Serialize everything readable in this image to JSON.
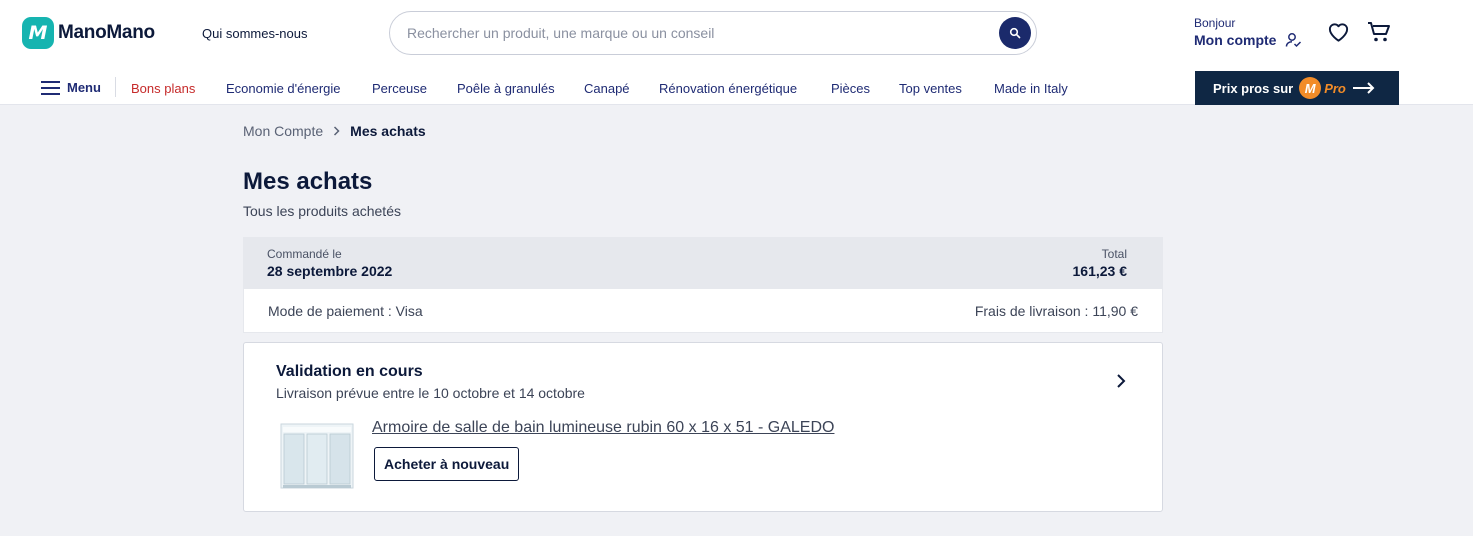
{
  "header": {
    "logo_text": "ManoMano",
    "logo_mark": "M",
    "about_link": "Qui sommes-nous",
    "search_placeholder": "Rechercher un produit, une marque ou un conseil",
    "greeting": "Bonjour",
    "account_label": "Mon compte"
  },
  "nav": {
    "menu_label": "Menu",
    "items": [
      "Bons plans",
      "Economie d'énergie",
      "Perceuse",
      "Poêle à granulés",
      "Canapé",
      "Rénovation énergétique",
      "Pièces",
      "Top ventes",
      "Made in Italy"
    ],
    "pro_banner": "Prix pros sur",
    "pro_word": "Pro",
    "pro_mark": "M"
  },
  "breadcrumb": {
    "parent": "Mon Compte",
    "current": "Mes achats"
  },
  "page": {
    "title": "Mes achats",
    "subtitle": "Tous les produits achetés"
  },
  "order": {
    "ordered_label": "Commandé le",
    "ordered_date": "28 septembre 2022",
    "total_label": "Total",
    "total_value": "161,23 €",
    "payment": "Mode de paiement : Visa",
    "shipping_fee": "Frais de livraison : 11,90 €"
  },
  "shipment": {
    "status": "Validation en cours",
    "delivery": "Livraison prévue entre le 10 octobre et 14 octobre",
    "product_name": "Armoire de salle de bain lumineuse rubin 60 x 16 x 51 - GALEDO",
    "rebuy_label": "Acheter à nouveau"
  },
  "colors": {
    "brand_teal": "#16b4b0",
    "navy": "#1b2a6b",
    "promo_red": "#c62a2a",
    "pro_orange": "#f28c28"
  }
}
